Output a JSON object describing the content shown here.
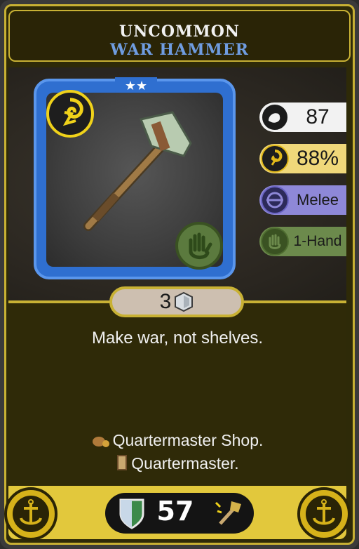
{
  "card": {
    "rarity": "UNCOMMON",
    "item_type": "WAR HAMMER",
    "stars": "★★",
    "stats": {
      "power": "87",
      "crit": "88%",
      "range": "Melee",
      "hands": "1-Hand"
    },
    "cost": "3",
    "flavor": "Make war, not shelves.",
    "sources": [
      "Quartermaster Shop.",
      "Quartermaster."
    ],
    "score": "57"
  },
  "icons": {
    "top_emblem": "lightning-swirl-icon",
    "bottom_emblem": "hand-icon",
    "power": "flexed-arm-icon",
    "crit": "swirl-icon",
    "range": "crosshair-icon",
    "hands": "hand-icon",
    "cost": "hexagon-gem-icon",
    "source_1": "coin-bag-icon",
    "source_2": "scroll-icon",
    "anchor": "anchor-icon",
    "shield": "shield-icon",
    "hammer": "hammer-icon"
  },
  "colors": {
    "frame_gold": "#c8b134",
    "rarity_blue": "#2f6fd0",
    "item_type_text": "#6f9ce0",
    "crit_yellow": "#f0d87a",
    "range_purple": "#8e88d8",
    "hand_green": "#6c8a4c"
  }
}
